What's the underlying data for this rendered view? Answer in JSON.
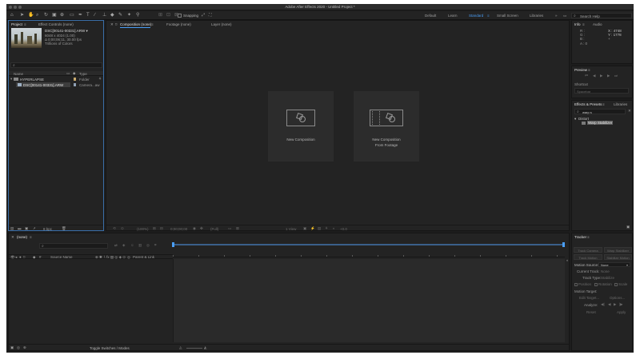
{
  "window": {
    "title": "Adobe After Effects 2020 - Untitled Project *"
  },
  "toolbar": {
    "snapping_label": "Snapping",
    "workspaces": [
      "Default",
      "Learn",
      "Standard",
      "Small Screen",
      "Libraries"
    ],
    "active_workspace": "Standard",
    "search_placeholder": "Search Help"
  },
  "project": {
    "tabs": [
      "Project",
      "Effect Controls (none)"
    ],
    "preview_info": {
      "filename": "DSC[00141-00331].ARW ▾",
      "line1": "6048 x 4024 (1.00)",
      "line2": "Δ 0;00;06;11, 30.00 fps",
      "line3": "Trillions of Colors"
    },
    "columns": [
      "Name",
      "Type"
    ],
    "items": [
      {
        "name": "HYPERLAPSE",
        "type": "Folder",
        "color": "#c9a96b"
      },
      {
        "name": "DSC[00141-00331].ARW",
        "type": "Camera...aw",
        "color": "#8fa0b4"
      }
    ],
    "bpc": "8 bpc"
  },
  "composition": {
    "tabs": [
      "Composition (none)",
      "Footage (none)",
      "Layer (none)"
    ],
    "new_comp_label": "New Composition",
    "new_comp_footage_label": [
      "New Composition",
      "From Footage"
    ],
    "footer_zoom": "(100%)",
    "footer_time": "0;00;00;00",
    "footer_res": "(Full)",
    "footer_view": "1 View",
    "footer_offset": "+0.0"
  },
  "info": {
    "tabs": [
      "Info",
      "Audio"
    ],
    "r": "R :",
    "g": "G :",
    "b": "B :",
    "a": "A : 0",
    "x": "X : 4748",
    "y": "Y : 1778"
  },
  "preview": {
    "title": "Preview",
    "shortcut_label": "Shortcut",
    "shortcut_value": "Spacebar"
  },
  "effects": {
    "tabs": [
      "Effects & Presets",
      "Libraries"
    ],
    "search_value": "warp s",
    "category": "Distort",
    "result": "Warp Stabilizer"
  },
  "timeline": {
    "tab": "(none)",
    "columns": [
      "Source Name",
      "Parent & Link"
    ],
    "footer_label": "Toggle Switches / Modes"
  },
  "tracker": {
    "title": "Tracker",
    "buttons_row1": [
      "Track Camera",
      "Warp Stabilizer"
    ],
    "buttons_row2": [
      "Track Motion",
      "Stabilize Motion"
    ],
    "motion_source_label": "Motion Source:",
    "motion_source_value": "None",
    "current_track_label": "Current Track:",
    "current_track_value": "None",
    "track_type_label": "Track Type:",
    "track_type_value": "Stabilize",
    "checks": [
      "Position",
      "Rotation",
      "Scale"
    ],
    "motion_target_label": "Motion Target:",
    "edit_target": "Edit Target...",
    "options": "Options...",
    "analyze_label": "Analyze:",
    "reset": "Reset",
    "apply": "Apply"
  }
}
